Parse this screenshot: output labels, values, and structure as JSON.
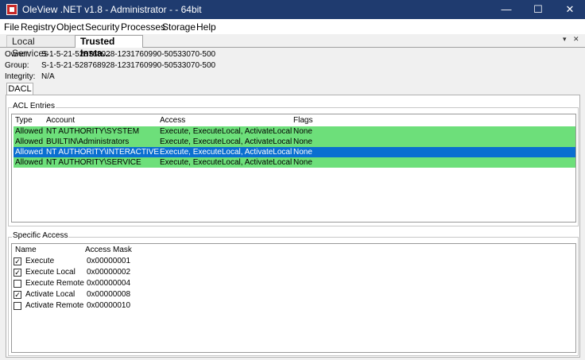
{
  "window": {
    "title": "OleView .NET v1.8 - Administrator - - 64bit",
    "minimize_glyph": "—",
    "maximize_glyph": "☐",
    "close_glyph": "✕"
  },
  "menu": [
    "File",
    "Registry",
    "Object",
    "Security",
    "Processes",
    "Storage",
    "Help"
  ],
  "tabs": [
    {
      "label": "Local Services"
    },
    {
      "label": "Trusted Insta..."
    }
  ],
  "tabstrip": {
    "dropdown_glyph": "▾",
    "close_glyph": "✕"
  },
  "info": {
    "owner_label": "Owner:",
    "owner_value": "S-1-5-21-528768928-1231760990-50533070-500",
    "group_label": "Group:",
    "group_value": "S-1-5-21-528768928-1231760990-50533070-500",
    "integrity_label": "Integrity:",
    "integrity_value": "N/A"
  },
  "dacl_tab": "DACL",
  "acl": {
    "title": "ACL Entries",
    "columns": [
      "Type",
      "Account",
      "Access",
      "Flags"
    ],
    "rows": [
      {
        "type": "Allowed",
        "account": "NT AUTHORITY\\SYSTEM",
        "access": "Execute, ExecuteLocal, ActivateLocal",
        "flags": "None",
        "selected": false
      },
      {
        "type": "Allowed",
        "account": "BUILTIN\\Administrators",
        "access": "Execute, ExecuteLocal, ActivateLocal",
        "flags": "None",
        "selected": false
      },
      {
        "type": "Allowed",
        "account": "NT AUTHORITY\\INTERACTIVE",
        "access": "Execute, ExecuteLocal, ActivateLocal",
        "flags": "None",
        "selected": true
      },
      {
        "type": "Allowed",
        "account": "NT AUTHORITY\\SERVICE",
        "access": "Execute, ExecuteLocal, ActivateLocal",
        "flags": "None",
        "selected": false
      }
    ],
    "row_colors": {
      "allowed": "#6ddf7a",
      "selected": "#0a6fd0"
    }
  },
  "specific": {
    "title": "Specific Access",
    "columns": [
      "Name",
      "Access Mask"
    ],
    "rows": [
      {
        "name": "Execute",
        "mask": "0x00000001",
        "checked": true
      },
      {
        "name": "Execute Local",
        "mask": "0x00000002",
        "checked": true
      },
      {
        "name": "Execute Remote",
        "mask": "0x00000004",
        "checked": false
      },
      {
        "name": "Activate Local",
        "mask": "0x00000008",
        "checked": true
      },
      {
        "name": "Activate Remote",
        "mask": "0x00000010",
        "checked": false
      }
    ]
  },
  "colors": {
    "titlebar": "#1f3b6f",
    "accent": "#0a6fd0"
  }
}
